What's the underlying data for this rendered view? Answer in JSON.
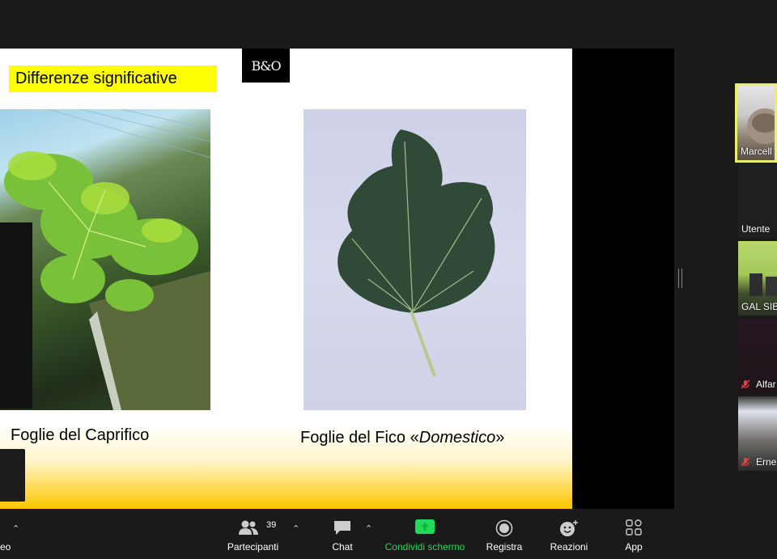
{
  "slide": {
    "title": "Differenze significative",
    "logo": "B&O",
    "caption_left": "Foglie del  Caprifico",
    "caption_right_prefix": "Foglie del Fico «",
    "caption_right_em": "Domestico",
    "caption_right_suffix": "»"
  },
  "participants": [
    {
      "name": "Marcell",
      "muted": false,
      "active": true
    },
    {
      "name": "Utente",
      "muted": false,
      "active": false
    },
    {
      "name": "GAL SIB",
      "muted": false,
      "active": false
    },
    {
      "name": "Alfar",
      "muted": true,
      "active": false
    },
    {
      "name": "Erne",
      "muted": true,
      "active": false
    }
  ],
  "toolbar": {
    "video_label": "eo",
    "participants_label": "Partecipanti",
    "participants_count": "39",
    "chat_label": "Chat",
    "share_label": "Condividi schermo",
    "record_label": "Registra",
    "reactions_label": "Reazioni",
    "apps_label": "App"
  },
  "colors": {
    "title_highlight": "#ffff00",
    "share_green": "#23d959",
    "active_border": "#e8f06a",
    "muted_red": "#e0443c"
  },
  "icons": [
    "participants-icon",
    "chat-icon",
    "share-screen-icon",
    "record-icon",
    "reactions-icon",
    "apps-icon",
    "muted-mic-icon"
  ]
}
